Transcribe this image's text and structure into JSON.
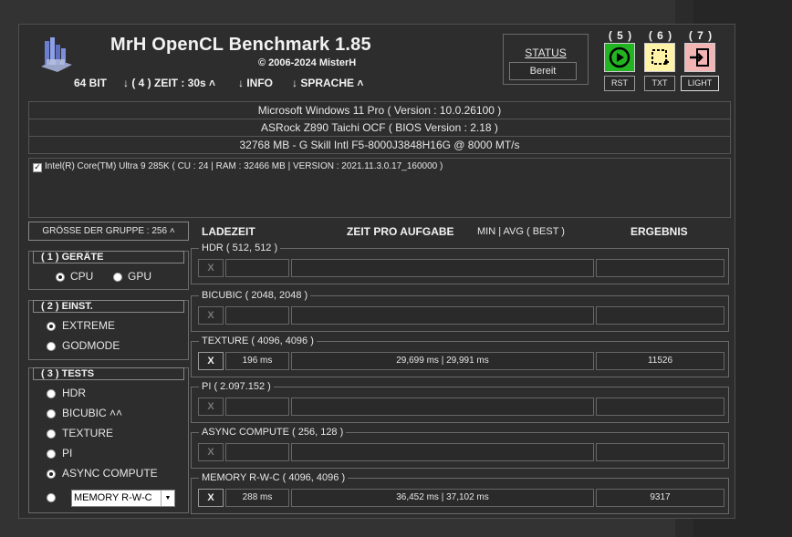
{
  "header": {
    "title": "MrH OpenCL Benchmark 1.85",
    "copyright": "© 2006-2024 MisterH",
    "menu": {
      "bits": "64 BIT",
      "zeit": "↓ ( 4 ) ZEIT : 30s ˄",
      "info": "↓ INFO",
      "sprache": "↓ SPRACHE ˄"
    }
  },
  "status": {
    "label": "STATUS",
    "value": "Bereit"
  },
  "toolbar": {
    "rst": {
      "num": "( 5 )",
      "label": "RST",
      "color": "#22b522"
    },
    "txt": {
      "num": "( 6 )",
      "label": "TXT",
      "color": "#fff3a8"
    },
    "light": {
      "num": "( 7 )",
      "label": "LIGHT",
      "color": "#f3b4b4"
    }
  },
  "system": {
    "os": "Microsoft Windows 11 Pro ( Version : 10.0.26100 )",
    "board": "ASRock Z890 Taichi OCF ( BIOS Version : 2.18 )",
    "memory": "32768 MB - G Skill Intl F5-8000J3848H16G    @ 8000 MT/s"
  },
  "device": {
    "checked": true,
    "text": "Intel(R) Core(TM) Ultra 9 285K ( CU : 24 | RAM : 32466 MB | VERSION : 2021.11.3.0.17_160000 )"
  },
  "group_size": "GRÖSSE DER GRUPPE : 256 ˄",
  "columns": {
    "ladezeit": "LADEZEIT",
    "zeit": "ZEIT PRO AUFGABE",
    "minavg": "MIN | AVG ( BEST )",
    "ergebnis": "ERGEBNIS"
  },
  "panels": {
    "geraete": {
      "title": "( 1 ) GERÄTE",
      "cpu": "CPU",
      "gpu": "GPU",
      "selected": "cpu"
    },
    "einst": {
      "title": "( 2 ) EINST.",
      "extreme": "EXTREME",
      "godmode": "GODMODE",
      "selected": "extreme"
    },
    "tests": {
      "title": "( 3 ) TESTS",
      "items": [
        "HDR",
        "BICUBIC ˄˄",
        "TEXTURE",
        "PI",
        "ASYNC COMPUTE"
      ],
      "selected": "ASYNC COMPUTE",
      "dropdown": "MEMORY R-W-C"
    }
  },
  "results": [
    {
      "name": "HDR ( 512, 512 )",
      "x": "X",
      "active": false,
      "load": "",
      "time": "",
      "score": ""
    },
    {
      "name": "BICUBIC ( 2048, 2048 )",
      "x": "X",
      "active": false,
      "load": "",
      "time": "",
      "score": ""
    },
    {
      "name": "TEXTURE ( 4096, 4096 )",
      "x": "X",
      "active": true,
      "load": "196 ms",
      "time": "29,699 ms | 29,991 ms",
      "score": "11526"
    },
    {
      "name": "PI ( 2.097.152 )",
      "x": "X",
      "active": false,
      "load": "",
      "time": "",
      "score": ""
    },
    {
      "name": "ASYNC COMPUTE ( 256, 128 )",
      "x": "X",
      "active": false,
      "load": "",
      "time": "",
      "score": ""
    },
    {
      "name": "MEMORY R-W-C ( 4096, 4096 )",
      "x": "X",
      "active": true,
      "load": "288 ms",
      "time": "36,452 ms | 37,102 ms",
      "score": "9317"
    }
  ]
}
